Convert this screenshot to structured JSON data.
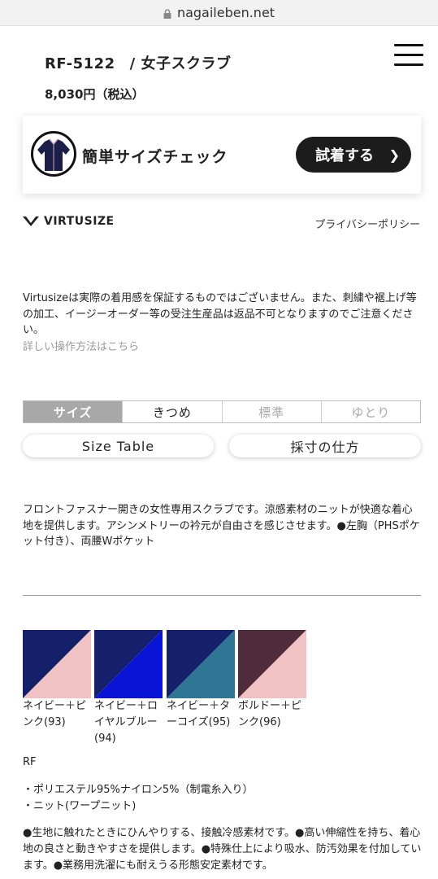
{
  "browser": {
    "url": "nagaileben.net"
  },
  "product": {
    "code": "RF-5122",
    "name": "/ 女子スクラブ",
    "price": "8,030円（税込）"
  },
  "virtusize": {
    "title": "簡単サイズチェック",
    "try_button": "試着する",
    "logo_text": "VIRTUSIZE",
    "privacy": "プライバシーポリシー",
    "notice": "Virtusizeは実際の着用感を保証するものではございません。また、刺繍や裾上げ等の加工、イージーオーダー等の受注生産品は返品不可となりますのでご注意ください。",
    "howto": "詳しい操作方法はこちら",
    "fit_tabs": [
      "サイズ",
      "きつめ",
      "標準",
      "ゆとり"
    ]
  },
  "buttons": {
    "size_table": "Size Table",
    "measure": "採寸の仕方"
  },
  "description": "フロントファスナー開きの女性専用スクラブです。涼感素材のニットが快適な着心地を提供します。アシンメトリーの衿元が自由さを感じさせます。●左胸（PHSポケット付き）、両腰Wポケット",
  "colors": [
    {
      "label": "ネイビー＋ピンク(93)",
      "c1": "#15206a",
      "c2": "#f1c2c4"
    },
    {
      "label": "ネイビー＋ロイヤルブルー(94)",
      "c1": "#15206a",
      "c2": "#0a14d6"
    },
    {
      "label": "ネイビー＋ターコイズ(95)",
      "c1": "#15206a",
      "c2": "#2f7596"
    },
    {
      "label": "ボルドー＋ピンク(96)",
      "c1": "#4e2c3a",
      "c2": "#f1c2c4"
    }
  ],
  "series": "RF",
  "materials": [
    "・ポリエステル95%ナイロン5%（制電糸入り）",
    "・ニット(ワープニット)"
  ],
  "features": "●生地に触れたときにひんやりする、接触冷感素材です。●高い伸縮性を持ち、着心地の良さと動きやすさを提供します。●特殊仕上により吸水、防汚効果を付加しています。●業務用洗濯にも耐えうる形態安定素材です。"
}
